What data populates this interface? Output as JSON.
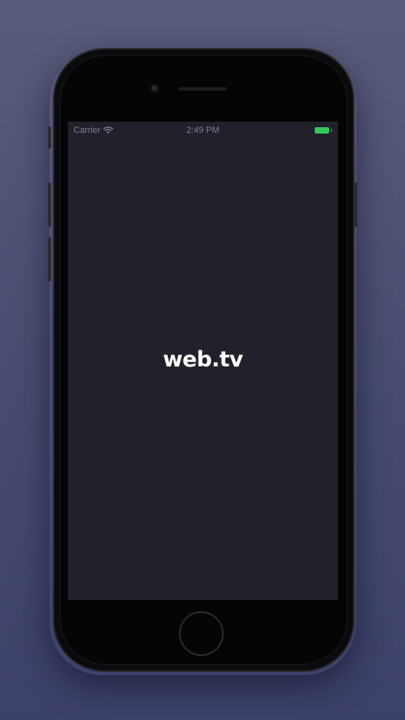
{
  "status_bar": {
    "carrier": "Carrier",
    "time": "2:49 PM",
    "battery_level": 1.0,
    "battery_color": "#34c759"
  },
  "splash": {
    "logo_text": "web.tv",
    "background_color": "#20212b"
  },
  "device": {
    "icons": [
      "wifi-icon",
      "battery-icon",
      "front-camera-icon",
      "home-button"
    ]
  }
}
